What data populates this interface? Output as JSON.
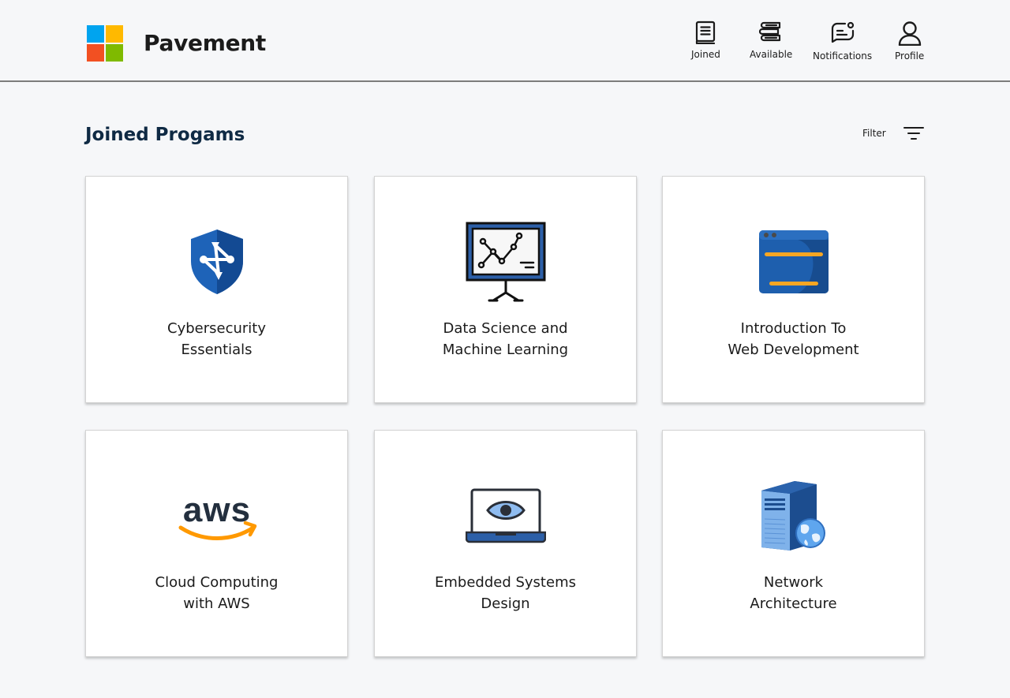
{
  "app": {
    "name": "Pavement",
    "logo_colors": [
      "#00a4ef",
      "#ffb900",
      "#f25022",
      "#7fba00"
    ]
  },
  "nav": [
    {
      "label": "Joined",
      "icon": "book-icon"
    },
    {
      "label": "Available",
      "icon": "books-stack-icon"
    },
    {
      "label": "Notifications",
      "icon": "message-notification-icon"
    },
    {
      "label": "Profile",
      "icon": "user-icon"
    }
  ],
  "section": {
    "title": "Joined Progams",
    "filter_label": "Filter"
  },
  "programs": [
    {
      "line1": "Cybersecurity",
      "line2": "Essentials",
      "icon": "shield-network-icon"
    },
    {
      "line1": "Data Science and",
      "line2": "Machine Learning",
      "icon": "data-chart-board-icon"
    },
    {
      "line1": "Introduction To",
      "line2": "Web Development",
      "icon": "browser-window-icon"
    },
    {
      "line1": "Cloud Computing",
      "line2": "with AWS",
      "icon": "aws-logo-icon",
      "logo_text": "aws"
    },
    {
      "line1": "Embedded Systems",
      "line2": "Design",
      "icon": "laptop-eye-icon"
    },
    {
      "line1": "Network",
      "line2": "Architecture",
      "icon": "server-globe-icon"
    }
  ]
}
